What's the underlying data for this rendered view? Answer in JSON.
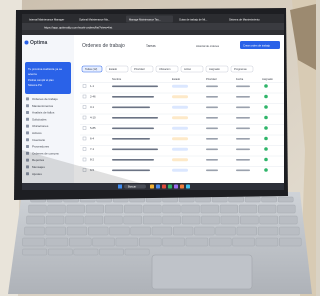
{
  "browser": {
    "tabs": [
      "Internal Maintenance Manager",
      "Optimal Maintenance Ma...",
      "Manage Maintenance Tas...",
      "Guias de trabajo de Mt...",
      "Sistema de Mantenimiento"
    ],
    "address": "https://app.optimaldy.com/work-orders/list?view=list"
  },
  "app": {
    "logo": "Optima",
    "banner": [
      "Tu proxima Auditoria ya se",
      "acerca",
      "Podras cumplir el plan",
      "Sistema Pro"
    ],
    "page_title": "Ordenes de trabajo",
    "tab": "Tareas",
    "header_links": [
      "Historial de ordenes",
      "Reporte",
      "Solicitar"
    ],
    "cta_label": "Crear orden de trabajo",
    "filter_active": "Todas (12)",
    "filters": [
      "Estado",
      "Prioridad",
      "Ubicacion",
      "Activo",
      "Asignado",
      "Programas"
    ],
    "columns": [
      "Nombre",
      "Estado",
      "Prioridad",
      "Fecha",
      "Asignado"
    ],
    "sidebar": [
      "Ordenes de trabajo",
      "Mantenimientos",
      "Analisis de fallos",
      "Solicitudes",
      "Ubicaciones",
      "Activos",
      "Inventario",
      "Proveedores",
      "Ordenes de compra",
      "Reportes",
      "Mensajes",
      "Ajustes"
    ],
    "row_ids": [
      "1-1",
      "2-46",
      "3-1",
      "4-10",
      "5-85",
      "6-4",
      "7-1",
      "8-2",
      "9-5"
    ]
  },
  "taskbar": {
    "search_label": "Buscar"
  },
  "palette": {
    "screen_bg": "#ffffff",
    "accent_blue": "#2a62e8",
    "bezel": "#1d1e22",
    "laptop_body": "#c9cdd2",
    "keycap": "#b7bbc1"
  }
}
